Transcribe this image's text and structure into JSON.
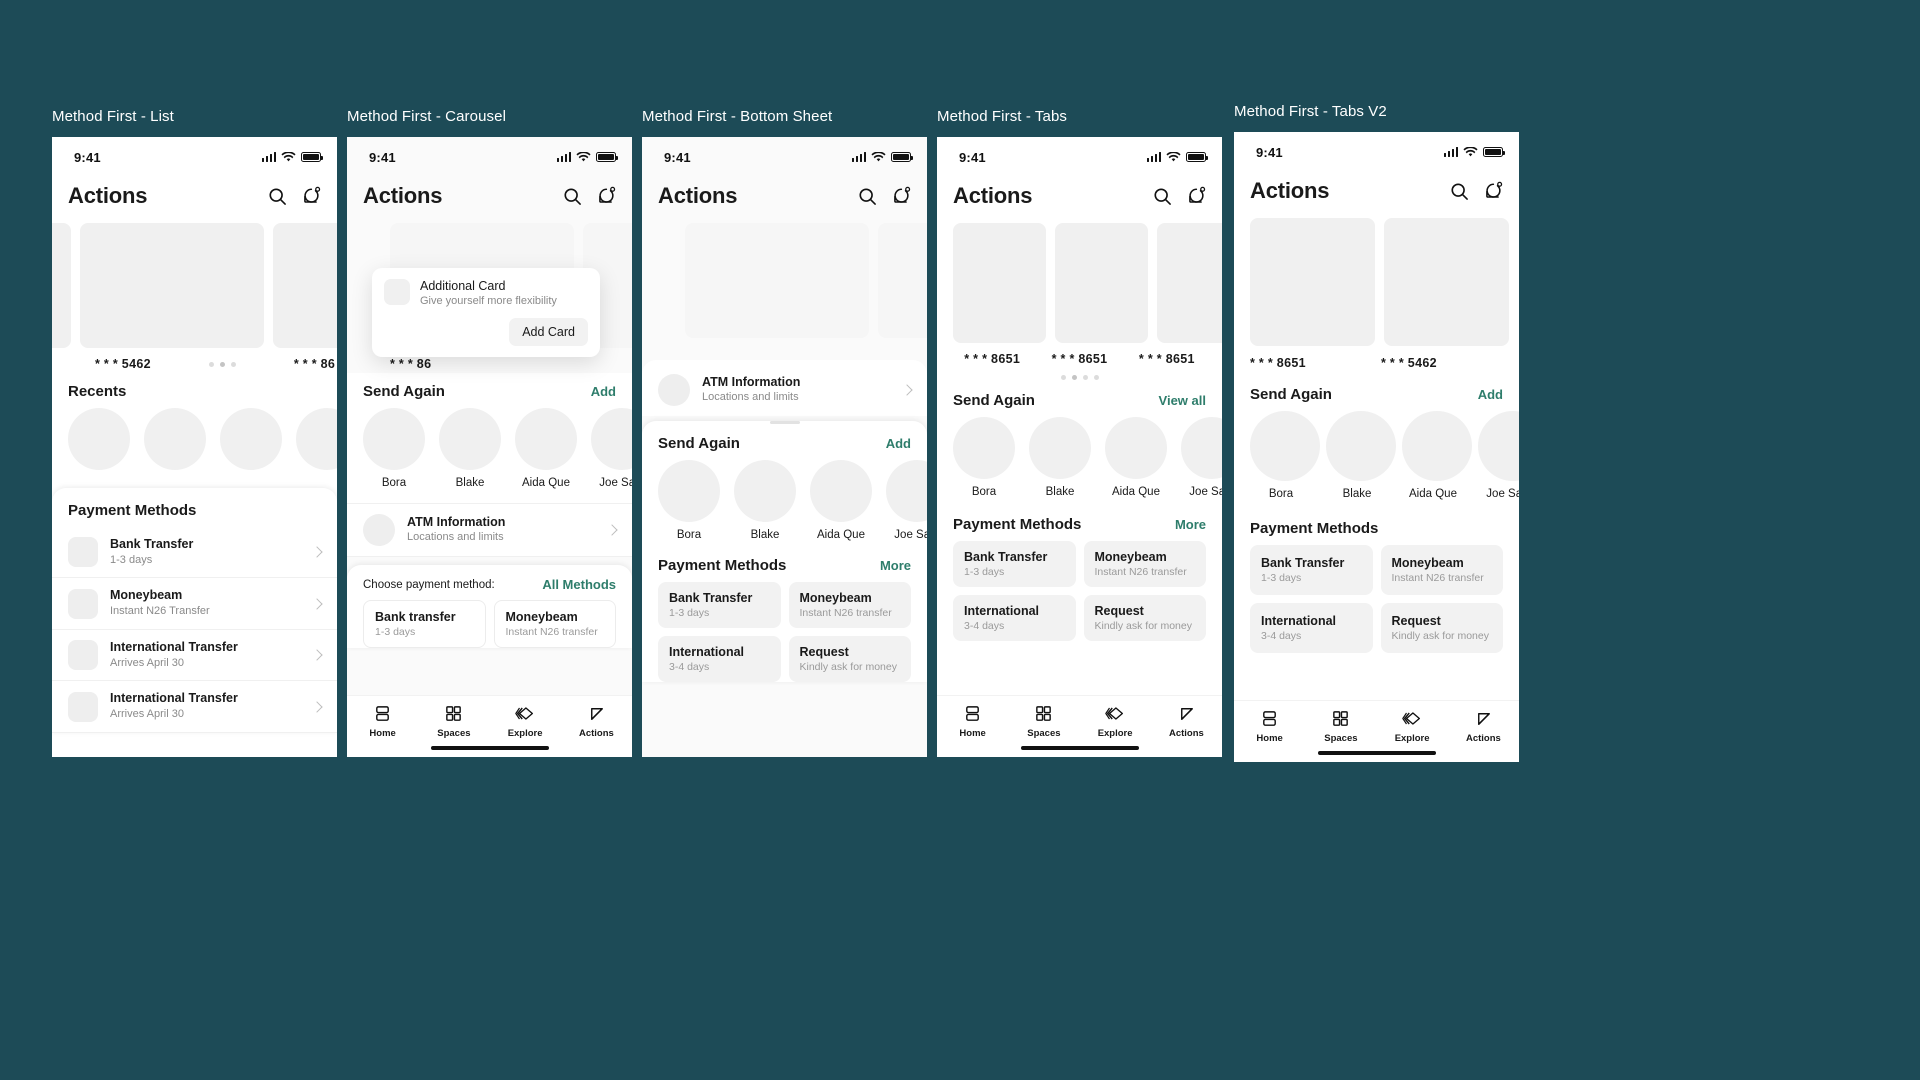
{
  "canvas": {
    "background": "#1d4b57",
    "accent": "#2e7d6b"
  },
  "frames": [
    {
      "title": "Method First - List"
    },
    {
      "title": "Method First - Carousel"
    },
    {
      "title": "Method First - Bottom Sheet"
    },
    {
      "title": "Method First - Tabs"
    },
    {
      "title": "Method First - Tabs V2"
    }
  ],
  "status_bar": {
    "time": "9:41",
    "signal_icon": "cellular-signal-icon",
    "wifi_icon": "wifi-icon",
    "battery_icon": "battery-icon"
  },
  "app_bar": {
    "title": "Actions",
    "search_icon": "search-icon",
    "notifications_icon": "notification-bell-icon"
  },
  "cards": {
    "label_5462": "* * * 5462",
    "label_8651": "* * * 8651",
    "label_8651_partial": "* * * 86"
  },
  "sections": {
    "recents": "Recents",
    "send_again": "Send Again",
    "payment_methods": "Payment Methods",
    "add": "Add",
    "more": "More",
    "view_all": "View all",
    "all_methods": "All Methods",
    "choose_payment_method": "Choose payment method:"
  },
  "contacts": [
    {
      "name": "Bora"
    },
    {
      "name": "Blake"
    },
    {
      "name": "Aida Que"
    },
    {
      "name": "Joe Sam"
    }
  ],
  "payment_rows": [
    {
      "title": "Bank Transfer",
      "subtitle": "1-3 days"
    },
    {
      "title": "Moneybeam",
      "subtitle": "Instant N26 Transfer"
    },
    {
      "title": "International Transfer",
      "subtitle": "Arrives April 30"
    },
    {
      "title": "International Transfer",
      "subtitle": "Arrives April 30"
    }
  ],
  "payment_tiles": [
    {
      "title": "Bank Transfer",
      "subtitle": "1-3 days"
    },
    {
      "title": "Moneybeam",
      "subtitle": "Instant N26 transfer"
    },
    {
      "title": "International",
      "subtitle": "3-4 days"
    },
    {
      "title": "Request",
      "subtitle": "Kindly ask for money"
    }
  ],
  "payment_tiles_carousel": [
    {
      "title": "Bank transfer",
      "subtitle": "1-3 days"
    },
    {
      "title": "Moneybeam",
      "subtitle": "Instant N26 transfer"
    }
  ],
  "atm": {
    "title": "ATM Information",
    "subtitle": "Locations and limits"
  },
  "additional_card": {
    "title": "Additional Card",
    "subtitle": "Give yourself more flexibility",
    "button": "Add Card"
  },
  "tab_bar": [
    {
      "label": "Home",
      "icon": "home-stacked-icon"
    },
    {
      "label": "Spaces",
      "icon": "spaces-grid-icon"
    },
    {
      "label": "Explore",
      "icon": "explore-chevrons-icon"
    },
    {
      "label": "Actions",
      "icon": "actions-arrow-icon"
    }
  ]
}
